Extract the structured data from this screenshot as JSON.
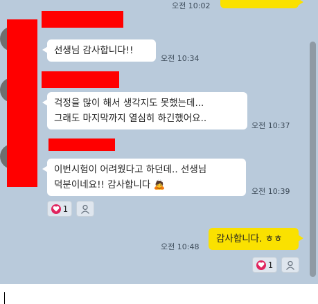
{
  "messages": [
    {
      "time": "오전 10:02"
    },
    {
      "text": "선생님 감사합니다!!",
      "time": "오전 10:34"
    },
    {
      "line1": "걱정을 많이 해서 생각지도 못했는데...",
      "line2": "그래도 마지막까지 열심히 하긴했어요..",
      "time": "오전 10:37"
    },
    {
      "line1": "이번시험이 어려웠다고 하던데.. 선생님",
      "line2": "덕분이네요!! 감사합니다",
      "emoji": "🙇",
      "time": "오전 10:39",
      "reaction_count": "1"
    },
    {
      "text": "감사합니다. ㅎㅎ",
      "time": "오전 10:48",
      "reaction_count": "1"
    }
  ],
  "icons": {
    "heart": "heart-icon",
    "person": "person-icon"
  },
  "colors": {
    "background": "#b9cadb",
    "my_bubble": "#fae100",
    "other_bubble": "#ffffff",
    "heart": "#e0245e",
    "redaction": "#ff0000"
  }
}
